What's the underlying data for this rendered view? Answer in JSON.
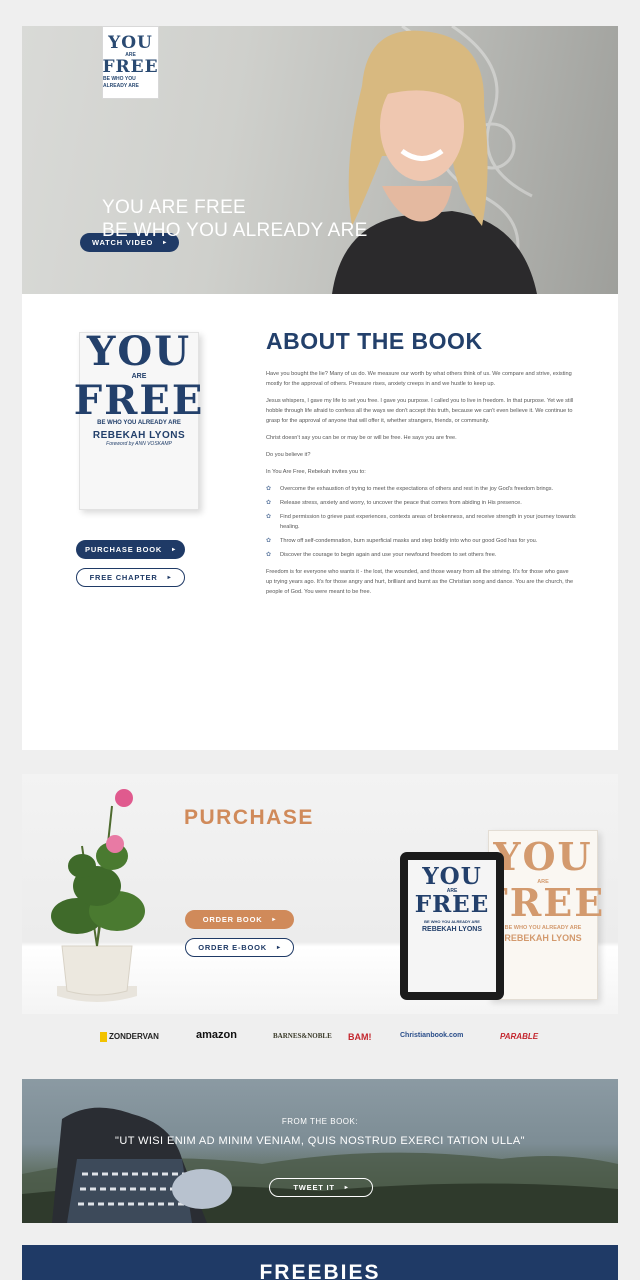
{
  "hero": {
    "logo_line1": "YOU",
    "logo_line2": "ARE",
    "logo_line3": "FREE",
    "logo_sub": "BE WHO YOU ALREADY ARE",
    "headline_1": "YOU ARE FREE",
    "headline_2": "BE WHO YOU ALREADY ARE",
    "watch_video_label": "WATCH VIDEO"
  },
  "about": {
    "title": "ABOUT THE BOOK",
    "cover": {
      "title_1": "YOU",
      "are": "ARE",
      "title_2": "FREE",
      "subtitle": "BE WHO YOU ALREADY ARE",
      "author": "REBEKAH LYONS",
      "foreword": "Foreword by ANN VOSKAMP"
    },
    "purchase_book_label": "PURCHASE BOOK",
    "free_chapter_label": "FREE CHAPTER",
    "paragraphs": [
      "Have you bought the lie? Many of us do. We measure our worth by what others think of us. We compare and strive, existing mostly for the approval of others. Pressure rises, anxiety creeps in and we hustle to keep up.",
      "Jesus whispers, I gave my life to set you free. I gave you purpose. I called you to live in freedom. In that purpose. Yet we still hobble through life afraid to confess all the ways we don't accept this truth, because we can't even believe it. We continue to grasp for the approval of anyone that will offer it, whether strangers, friends, or community.",
      "Christ doesn't say you can be or may be or will be free. He says you are free.",
      "Do you believe it?",
      "In You Are Free, Rebekah invites you to:"
    ],
    "bullets": [
      "Overcome the exhaustion of trying to meet the expectations of others and rest in the joy God's freedom brings.",
      "Release stress, anxiety and worry, to uncover the peace that comes from abiding in His presence.",
      "Find permission to grieve past experiences, contexts areas of brokenness, and receive strength in your journey towards healing.",
      "Throw off self-condemnation, burn superficial masks and step boldly into who our good God has for you.",
      "Discover the courage to begin again and use your newfound freedom to set others free."
    ],
    "closing": "Freedom is for everyone who wants it - the lost, the wounded, and those weary from all the striving. It's for those who gave up trying years ago. It's for those angry and hurt, brilliant and burnt as the Christian song and dance. You are the church, the people of God. You were meant to be free."
  },
  "purchase": {
    "title": "PURCHASE",
    "order_book_label": "ORDER BOOK",
    "order_ebook_label": "ORDER E-BOOK",
    "ebook": {
      "title_1": "YOU",
      "are": "ARE",
      "title_2": "FREE",
      "subtitle": "BE WHO YOU ALREADY ARE",
      "author": "REBEKAH LYONS"
    },
    "hardcover": {
      "title_1": "YOU",
      "are": "ARE",
      "title_2": "FREE",
      "subtitle": "BE WHO YOU ALREADY ARE",
      "author": "REBEKAH LYONS"
    }
  },
  "retailers": [
    "ZONDERVAN",
    "amazon",
    "BARNES&NOBLE",
    "BAM!",
    "Christianbook.com",
    "PARABLE"
  ],
  "quote": {
    "label": "FROM THE BOOK:",
    "text": "\"UT WISI ENIM AD MINIM VENIAM, QUIS NOSTRUD EXERCI TATION ULLA\"",
    "tweet_label": "TWEET IT"
  },
  "freebies": {
    "title": "FREEBIES"
  },
  "colors": {
    "navy": "#1f3a66",
    "orange": "#d08a5a"
  }
}
